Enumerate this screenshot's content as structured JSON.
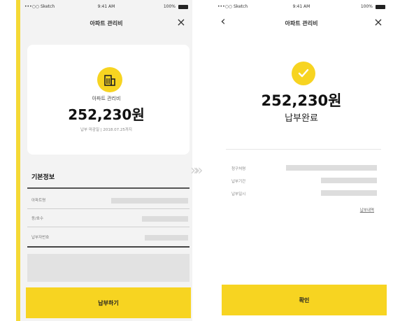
{
  "left_screen": {
    "status": {
      "carrier": "•••○○ Sketch",
      "time": "9:41 AM",
      "battery": "100%"
    },
    "title": "아파트 관리비",
    "close_icon": "×",
    "summary": {
      "icon": "building-icon",
      "label": "아파트 관리비",
      "amount": "252,230원",
      "due_text": "납부 마감일 | 2018.07.25까지"
    },
    "section_title": "기본정보",
    "rows": [
      {
        "label": "아파트명"
      },
      {
        "label": "동/호수"
      },
      {
        "label": "납부자번호"
      }
    ],
    "cta_label": "납부하기"
  },
  "transition_arrows": "»»",
  "right_screen": {
    "status": {
      "carrier": "•••○○ Sketch",
      "time": "9:41 AM",
      "battery": "100%"
    },
    "back_icon": "‹",
    "title": "아파트 관리비",
    "close_icon": "×",
    "status_icon": "check-icon",
    "amount": "252,230원",
    "status_text": "납부완료",
    "rows": [
      {
        "label": "청구처명"
      },
      {
        "label": "납부기간"
      },
      {
        "label": "납부일시"
      }
    ],
    "detail_link": "납부내역",
    "confirm_label": "확인"
  },
  "colors": {
    "accent": "#f7d421",
    "left_background": "#f3f3f3",
    "placeholder_bar": "#dcdcdc"
  }
}
